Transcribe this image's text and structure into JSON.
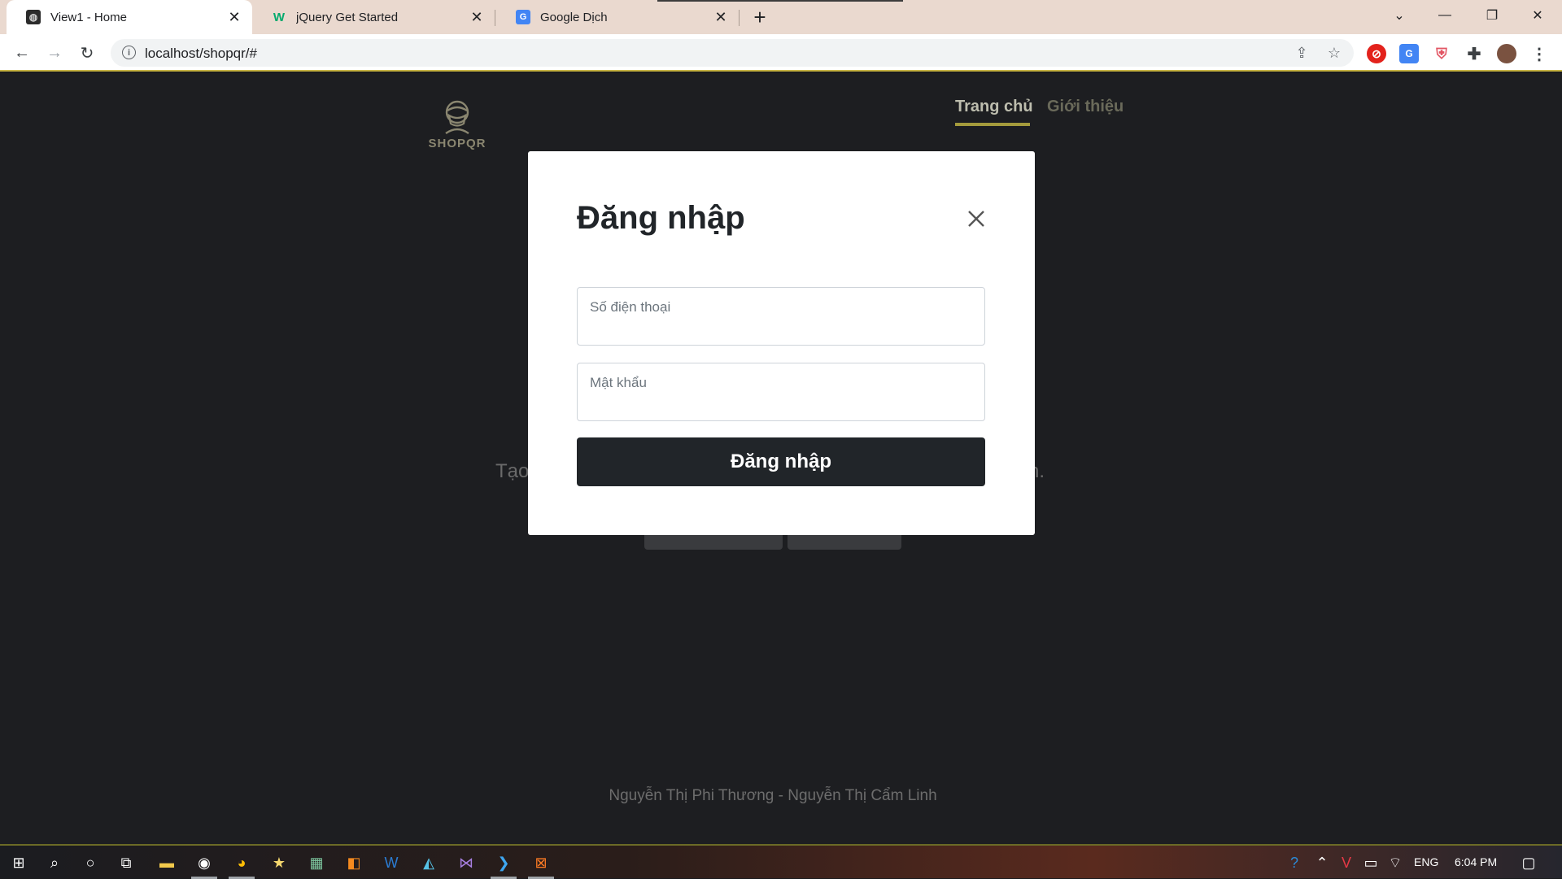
{
  "browser": {
    "tabs": [
      {
        "title": "View1 - Home",
        "favicon": "shopqr-favicon",
        "active": true
      },
      {
        "title": "jQuery Get Started",
        "favicon": "w3schools-favicon",
        "active": false
      },
      {
        "title": "Google Dịch",
        "favicon": "google-translate-favicon",
        "active": false
      }
    ],
    "url": "localhost/shopqr/#"
  },
  "site": {
    "logo_text": "SHOPQR",
    "nav": [
      {
        "label": "Trang chủ",
        "active": true
      },
      {
        "label": "Giới thiệu",
        "active": false
      }
    ],
    "hero_text_left": "Tạo",
    "hero_text_right": "n.",
    "footer": "Nguyễn Thị Phi Thương - Nguyễn Thị Cẩm Linh"
  },
  "modal": {
    "title": "Đăng nhập",
    "phone_placeholder": "Số điện thoại",
    "password_placeholder": "Mật khẩu",
    "submit_label": "Đăng nhập"
  },
  "taskbar": {
    "language": "ENG",
    "time": "6:04 PM"
  },
  "colors": {
    "accent": "#a49b3c",
    "modal_button": "#212529",
    "page_bg": "#1d1e21"
  }
}
